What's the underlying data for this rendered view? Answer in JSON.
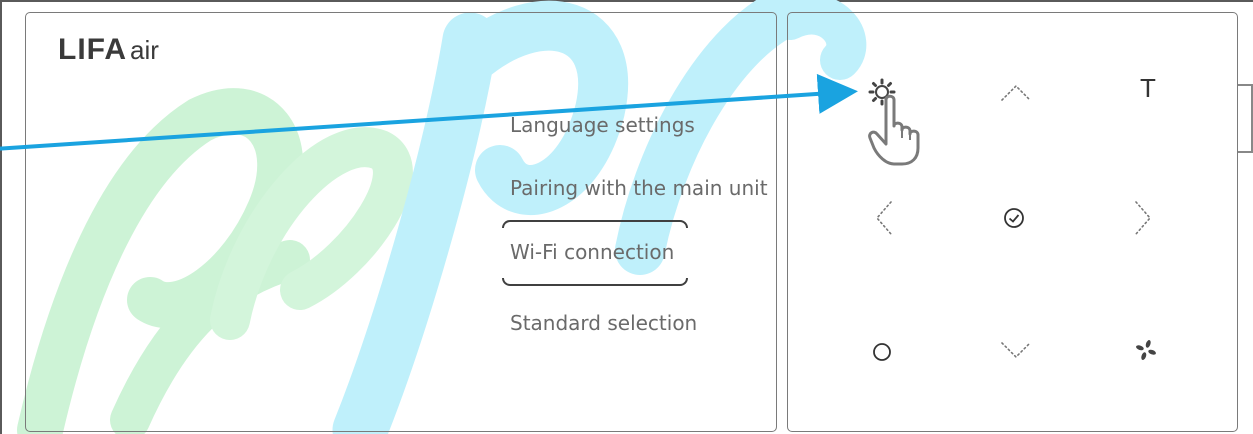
{
  "brand": {
    "name": "LIFA",
    "sub": "air"
  },
  "menu": [
    {
      "label": "Language settings"
    },
    {
      "label": "Pairing with the main unit"
    },
    {
      "label": "Wi-Fi connection",
      "selected": true
    },
    {
      "label": "Standard selection"
    }
  ],
  "keypad": {
    "keys": [
      {
        "icon": "gear-icon"
      },
      {
        "icon": "chevron-up-icon"
      },
      {
        "icon": "temperature-t-icon",
        "label": "T"
      },
      {
        "icon": "chevron-left-icon"
      },
      {
        "icon": "check-circle-icon"
      },
      {
        "icon": "chevron-right-icon"
      },
      {
        "icon": "power-circle-icon"
      },
      {
        "icon": "chevron-down-icon"
      },
      {
        "icon": "fan-icon"
      }
    ],
    "pointer": "hand-pointer-icon"
  },
  "colors": {
    "arrow": "#1aa3e0",
    "watermark_green": "#cdf3d6",
    "watermark_blue": "#bff0fb",
    "text": "#6a6a6a"
  }
}
